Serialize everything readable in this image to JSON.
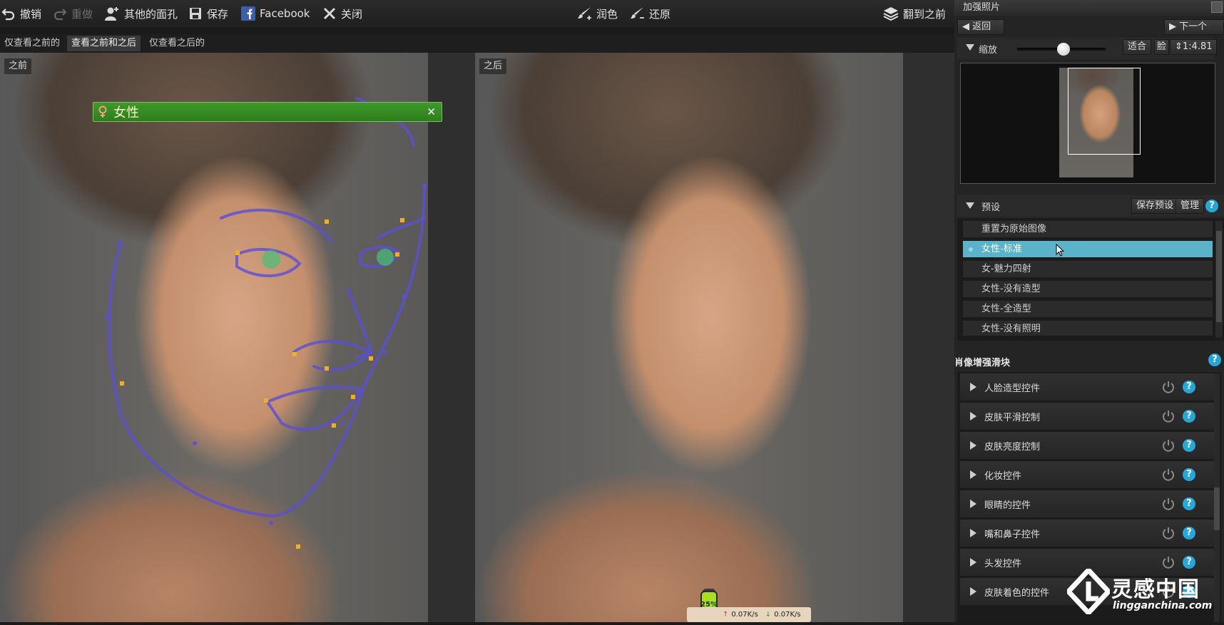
{
  "toolbar": {
    "undo": "撤销",
    "redo": "重做",
    "other_faces": "其他的面孔",
    "save": "保存",
    "facebook": "Facebook",
    "close": "关闭",
    "retouch": "润色",
    "restore": "还原",
    "flip_to_before": "翻到之前"
  },
  "view_tabs": [
    "仅查看之前的",
    "查看之前和之后",
    "仅查看之后的"
  ],
  "active_view_tab": 1,
  "canvas": {
    "before_label": "之前",
    "after_label": "之后",
    "gender_tag": "女性"
  },
  "status": {
    "zoom_badge": "25%",
    "upload_speed": "0.07K/s",
    "download_speed": "0.07K/s"
  },
  "panel": {
    "title": "加强照片",
    "back": "返回",
    "next": "下一个",
    "zoom": {
      "label": "缩放",
      "fit": "适合",
      "face": "脸",
      "ratio": "1:4.81",
      "level": 0.2
    },
    "presets": {
      "label": "预设",
      "save_preset": "保存预设",
      "manage": "管理",
      "items": [
        "重置为原始图像",
        "女性-标准",
        "女-魅力四射",
        "女性-没有造型",
        "女性-全造型",
        "女性-没有照明"
      ],
      "selected_index": 1
    },
    "sliders": {
      "label": "肖像增强滑块",
      "items": [
        "人脸造型控件",
        "皮肤平滑控制",
        "皮肤亮度控制",
        "化妆控件",
        "眼睛的控件",
        "嘴和鼻子控件",
        "头发控件",
        "皮肤着色的控件"
      ]
    }
  },
  "watermark": {
    "brand": "灵感中国",
    "url": "lingganchina.com"
  },
  "colors": {
    "selection": "#5ab3c8",
    "help_icon": "#27a7d8",
    "gender_bar": "#3f9a2a",
    "face_lines": "#5b4fd6",
    "face_points": "#f0b020"
  }
}
